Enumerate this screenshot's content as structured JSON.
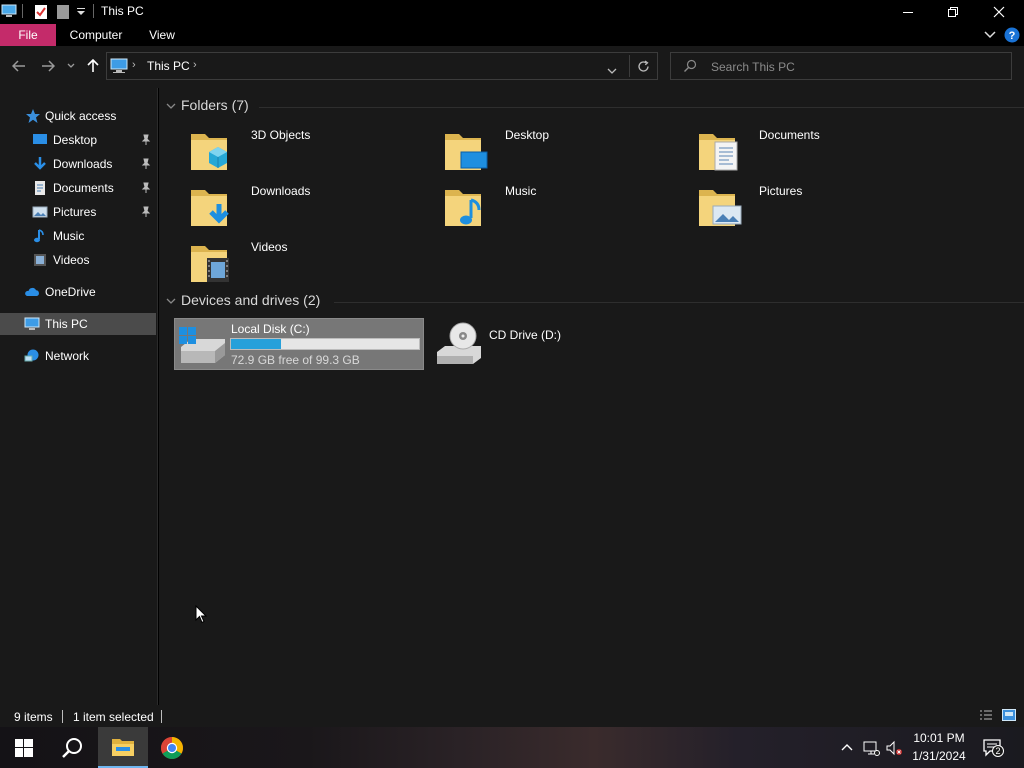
{
  "window": {
    "title": "This PC"
  },
  "ribbon": {
    "tabs": [
      "File",
      "Computer",
      "View"
    ]
  },
  "address": {
    "path_label": "This PC"
  },
  "search": {
    "placeholder": "Search This PC"
  },
  "sidebar": {
    "items": [
      {
        "label": "Quick access",
        "icon": "star-icon"
      },
      {
        "label": "Desktop",
        "icon": "desktop-icon",
        "pinned": true
      },
      {
        "label": "Downloads",
        "icon": "download-icon",
        "pinned": true
      },
      {
        "label": "Documents",
        "icon": "documents-icon",
        "pinned": true
      },
      {
        "label": "Pictures",
        "icon": "pictures-icon",
        "pinned": true
      },
      {
        "label": "Music",
        "icon": "music-icon"
      },
      {
        "label": "Videos",
        "icon": "videos-icon"
      },
      {
        "label": "OneDrive",
        "icon": "cloud-icon"
      },
      {
        "label": "This PC",
        "icon": "pc-icon",
        "selected": true
      },
      {
        "label": "Network",
        "icon": "network-icon"
      }
    ]
  },
  "main": {
    "folders_header": "Folders (7)",
    "folders": [
      {
        "label": "3D Objects",
        "icon": "3d-objects-folder-icon"
      },
      {
        "label": "Desktop",
        "icon": "desktop-folder-icon"
      },
      {
        "label": "Documents",
        "icon": "documents-folder-icon"
      },
      {
        "label": "Downloads",
        "icon": "downloads-folder-icon"
      },
      {
        "label": "Music",
        "icon": "music-folder-icon"
      },
      {
        "label": "Pictures",
        "icon": "pictures-folder-icon"
      },
      {
        "label": "Videos",
        "icon": "videos-folder-icon"
      }
    ],
    "drives_header": "Devices and drives (2)",
    "drives": [
      {
        "label": "Local Disk (C:)",
        "free_text": "72.9 GB free of 99.3 GB",
        "used_fraction": 0.266,
        "selected": true,
        "icon": "hard-disk-icon"
      },
      {
        "label": "CD Drive (D:)",
        "icon": "cd-drive-icon"
      }
    ]
  },
  "status": {
    "item_count": "9 items",
    "selection": "1 item selected"
  },
  "taskbar": {
    "clock_time": "10:01 PM",
    "clock_date": "1/31/2024",
    "notification_count": "2"
  },
  "colors": {
    "accent_file_tab": "#c42b6a",
    "drive_bar": "#26a0da",
    "bg": "#191919"
  }
}
